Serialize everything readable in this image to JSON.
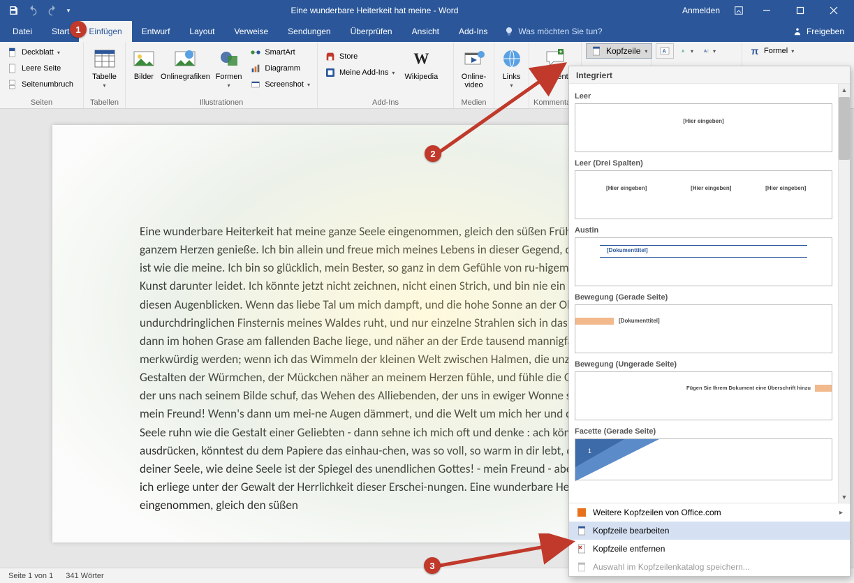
{
  "titlebar": {
    "title": "Eine wunderbare Heiterkeit hat meine - Word",
    "signin": "Anmelden"
  },
  "tabs": {
    "items": [
      "Datei",
      "Start",
      "Einfügen",
      "Entwurf",
      "Layout",
      "Verweise",
      "Sendungen",
      "Überprüfen",
      "Ansicht",
      "Add-Ins"
    ],
    "active_index": 2,
    "tell_me": "Was möchten Sie tun?",
    "share": "Freigeben"
  },
  "ribbon": {
    "groups": {
      "seiten": {
        "label": "Seiten",
        "deckblatt": "Deckblatt",
        "leere_seite": "Leere Seite",
        "seitenumbruch": "Seitenumbruch"
      },
      "tabellen": {
        "label": "Tabellen",
        "tabelle": "Tabelle"
      },
      "illustrationen": {
        "label": "Illustrationen",
        "bilder": "Bilder",
        "onlinegrafiken": "Onlinegrafiken",
        "formen": "Formen",
        "smartart": "SmartArt",
        "diagramm": "Diagramm",
        "screenshot": "Screenshot"
      },
      "addins": {
        "label": "Add-Ins",
        "store": "Store",
        "meine_addins": "Meine Add-Ins",
        "wikipedia": "Wikipedia"
      },
      "medien": {
        "label": "Medien",
        "onlinevideo": "Online-\nvideo"
      },
      "links_g": {
        "label": "",
        "links": "Links"
      },
      "kommentare": {
        "label": "Kommentare",
        "kommentar": "Kommentar"
      },
      "kopfzeile": "Kopfzeile",
      "formel": "Formel"
    }
  },
  "gallery": {
    "section": "Integriert",
    "items": [
      {
        "title": "Leer",
        "placeholders": [
          "[Hier eingeben]"
        ]
      },
      {
        "title": "Leer (Drei Spalten)",
        "placeholders": [
          "[Hier eingeben]",
          "[Hier eingeben]",
          "[Hier eingeben]"
        ]
      },
      {
        "title": "Austin",
        "placeholders": [
          "[Dokumenttitel]"
        ]
      },
      {
        "title": "Bewegung (Gerade Seite)",
        "placeholders": [
          "[Dokumenttitel]"
        ]
      },
      {
        "title": "Bewegung (Ungerade Seite)",
        "placeholders": [
          "Fügen Sie Ihrem Dokument eine Überschrift hinzu"
        ]
      },
      {
        "title": "Facette (Gerade Seite)",
        "placeholders": [
          "1"
        ]
      }
    ],
    "footer": {
      "more": "Weitere Kopfzeilen von Office.com",
      "edit": "Kopfzeile bearbeiten",
      "remove": "Kopfzeile entfernen",
      "save_to": "Auswahl im Kopfzeilenkatalog speichern..."
    }
  },
  "footer_underline_letters": {
    "more": "W",
    "edit": "K",
    "remove": "e"
  },
  "document": {
    "text": "Eine wunderbare Heiterkeit hat meine ganze Seele eingenommen, gleich den süßen Frühlingsmorgen, die ich mit ganzem Herzen genieße. Ich bin allein und freue mich meines Lebens in dieser Gegend, die für solche Seelen geschaffen ist wie die meine. Ich bin so glücklich, mein Bester, so ganz in dem Gefühle von ru-higem Dasein versunken, daß meine Kunst darunter leidet. Ich könnte jetzt nicht zeichnen, nicht einen Strich, und bin nie ein größerer Maler gewesen als in diesen Augenblicken. Wenn das liebe Tal um mich dampft, und die hohe Sonne an der Oberfläche der undurchdringlichen Finsternis meines Waldes ruht, und nur einzelne Strahlen sich in das innere Heiligtum stehlen, ich dann im hohen Grase am fallenden Bache liege, und näher an der Erde tausend mannigfaltige Gräs-chen mir merkwürdig werden; wenn ich das Wimmeln der kleinen Welt zwischen Halmen, die unzähligen, unergründlichen Gestalten der Würmchen, der Mückchen näher an meinem Herzen fühle, und fühle die Gegenwart des Allmäch-tigen, der uns nach seinem Bilde schuf, das Wehen des Alliebenden, der uns in ewiger Wonne schwebend trägt und erhält; mein Freund! Wenn's dann um mei-ne Augen dämmert, und die Welt um mich her und der Himmel ganz in meiner Seele ruhn wie die Gestalt einer Geliebten - dann sehne ich mich oft und denke : ach könntest du das wieder ausdrücken, könntest du dem Papiere das einhau-chen, was so voll, so warm in dir lebt, daß es würde der Spiegel deiner Seele, wie deine Seele ist der Spiegel des unendlichen Gottes! - mein Freund - aber ich gehe darüber zugrunde, ich erliege unter der Gewalt der Herrlichkeit dieser Erschei-nungen. Eine wunderbare Heiterkeit hat meine ganze Seele eingenommen, gleich den süßen"
  },
  "status": {
    "page": "Seite 1 von 1",
    "words": "341 Wörter"
  },
  "callouts": {
    "one": "1",
    "two": "2",
    "three": "3"
  },
  "colors": {
    "accent": "#2b579a",
    "callout": "#c0392b",
    "motion_bar": "#f2b98c"
  }
}
